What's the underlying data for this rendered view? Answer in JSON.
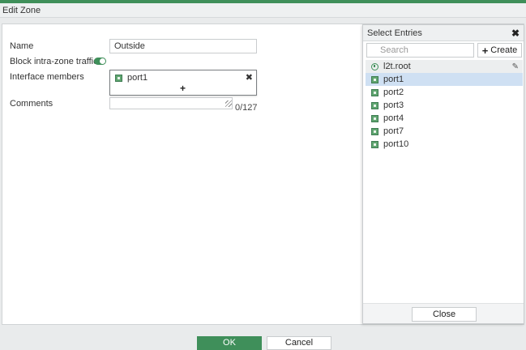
{
  "window": {
    "title": "Edit Zone",
    "accent": "#3f8f5a"
  },
  "form": {
    "name_label": "Name",
    "name_value": "Outside",
    "block_label": "Block intra-zone traffic",
    "block_enabled": true,
    "members_label": "Interface members",
    "members": [
      {
        "label": "port1",
        "icon": "port-icon"
      }
    ],
    "add_glyph": "+",
    "remove_glyph": "✖",
    "comments_label": "Comments",
    "comments_value": "",
    "comments_counter": "0/127"
  },
  "selector": {
    "title": "Select Entries",
    "close_glyph": "✖",
    "search_placeholder": "Search",
    "create_label": "Create",
    "entries": [
      {
        "label": "l2t.root",
        "icon": "tunnel-icon",
        "state": "hover"
      },
      {
        "label": "port1",
        "icon": "port-icon",
        "state": "selected"
      },
      {
        "label": "port2",
        "icon": "port-icon",
        "state": ""
      },
      {
        "label": "port3",
        "icon": "port-icon",
        "state": ""
      },
      {
        "label": "port4",
        "icon": "port-icon",
        "state": ""
      },
      {
        "label": "port7",
        "icon": "port-icon",
        "state": ""
      },
      {
        "label": "port10",
        "icon": "port-icon",
        "state": ""
      }
    ],
    "close_label": "Close"
  },
  "footer": {
    "ok_label": "OK",
    "cancel_label": "Cancel"
  }
}
